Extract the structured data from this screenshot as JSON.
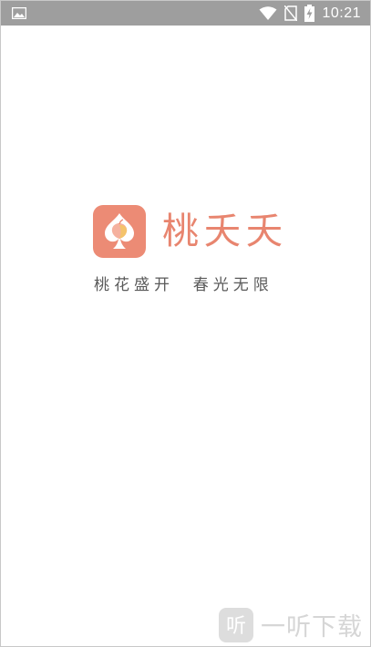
{
  "status_bar": {
    "time": "10:21",
    "icons": {
      "left": "image-notification-icon",
      "wifi": "wifi-icon",
      "sim": "no-sim-icon",
      "battery": "battery-charging-icon"
    }
  },
  "splash": {
    "app_name": "桃夭夭",
    "slogan": "桃花盛开  春光无限",
    "icon": "peach-spade-icon"
  },
  "watermark": {
    "text": "一听下载",
    "logo_text": "听"
  },
  "colors": {
    "brand": "#e8856f",
    "icon_bg": "#ec8b75",
    "status_bar": "#9e9e9e",
    "slogan": "#5a5a5a"
  }
}
